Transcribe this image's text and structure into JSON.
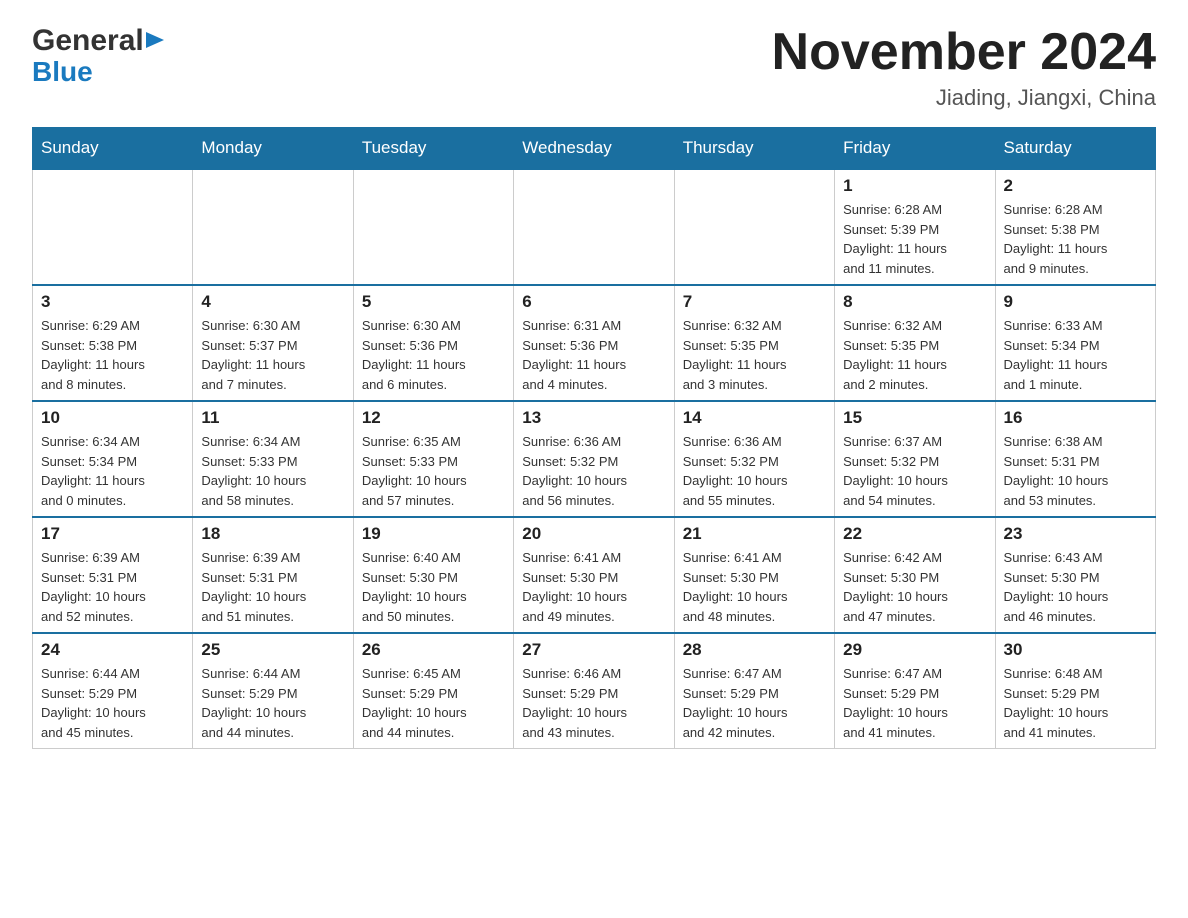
{
  "header": {
    "logo_general": "General",
    "logo_blue": "Blue",
    "main_title": "November 2024",
    "subtitle": "Jiading, Jiangxi, China"
  },
  "weekdays": [
    "Sunday",
    "Monday",
    "Tuesday",
    "Wednesday",
    "Thursday",
    "Friday",
    "Saturday"
  ],
  "weeks": [
    {
      "days": [
        {
          "number": "",
          "info": ""
        },
        {
          "number": "",
          "info": ""
        },
        {
          "number": "",
          "info": ""
        },
        {
          "number": "",
          "info": ""
        },
        {
          "number": "",
          "info": ""
        },
        {
          "number": "1",
          "info": "Sunrise: 6:28 AM\nSunset: 5:39 PM\nDaylight: 11 hours\nand 11 minutes."
        },
        {
          "number": "2",
          "info": "Sunrise: 6:28 AM\nSunset: 5:38 PM\nDaylight: 11 hours\nand 9 minutes."
        }
      ]
    },
    {
      "days": [
        {
          "number": "3",
          "info": "Sunrise: 6:29 AM\nSunset: 5:38 PM\nDaylight: 11 hours\nand 8 minutes."
        },
        {
          "number": "4",
          "info": "Sunrise: 6:30 AM\nSunset: 5:37 PM\nDaylight: 11 hours\nand 7 minutes."
        },
        {
          "number": "5",
          "info": "Sunrise: 6:30 AM\nSunset: 5:36 PM\nDaylight: 11 hours\nand 6 minutes."
        },
        {
          "number": "6",
          "info": "Sunrise: 6:31 AM\nSunset: 5:36 PM\nDaylight: 11 hours\nand 4 minutes."
        },
        {
          "number": "7",
          "info": "Sunrise: 6:32 AM\nSunset: 5:35 PM\nDaylight: 11 hours\nand 3 minutes."
        },
        {
          "number": "8",
          "info": "Sunrise: 6:32 AM\nSunset: 5:35 PM\nDaylight: 11 hours\nand 2 minutes."
        },
        {
          "number": "9",
          "info": "Sunrise: 6:33 AM\nSunset: 5:34 PM\nDaylight: 11 hours\nand 1 minute."
        }
      ]
    },
    {
      "days": [
        {
          "number": "10",
          "info": "Sunrise: 6:34 AM\nSunset: 5:34 PM\nDaylight: 11 hours\nand 0 minutes."
        },
        {
          "number": "11",
          "info": "Sunrise: 6:34 AM\nSunset: 5:33 PM\nDaylight: 10 hours\nand 58 minutes."
        },
        {
          "number": "12",
          "info": "Sunrise: 6:35 AM\nSunset: 5:33 PM\nDaylight: 10 hours\nand 57 minutes."
        },
        {
          "number": "13",
          "info": "Sunrise: 6:36 AM\nSunset: 5:32 PM\nDaylight: 10 hours\nand 56 minutes."
        },
        {
          "number": "14",
          "info": "Sunrise: 6:36 AM\nSunset: 5:32 PM\nDaylight: 10 hours\nand 55 minutes."
        },
        {
          "number": "15",
          "info": "Sunrise: 6:37 AM\nSunset: 5:32 PM\nDaylight: 10 hours\nand 54 minutes."
        },
        {
          "number": "16",
          "info": "Sunrise: 6:38 AM\nSunset: 5:31 PM\nDaylight: 10 hours\nand 53 minutes."
        }
      ]
    },
    {
      "days": [
        {
          "number": "17",
          "info": "Sunrise: 6:39 AM\nSunset: 5:31 PM\nDaylight: 10 hours\nand 52 minutes."
        },
        {
          "number": "18",
          "info": "Sunrise: 6:39 AM\nSunset: 5:31 PM\nDaylight: 10 hours\nand 51 minutes."
        },
        {
          "number": "19",
          "info": "Sunrise: 6:40 AM\nSunset: 5:30 PM\nDaylight: 10 hours\nand 50 minutes."
        },
        {
          "number": "20",
          "info": "Sunrise: 6:41 AM\nSunset: 5:30 PM\nDaylight: 10 hours\nand 49 minutes."
        },
        {
          "number": "21",
          "info": "Sunrise: 6:41 AM\nSunset: 5:30 PM\nDaylight: 10 hours\nand 48 minutes."
        },
        {
          "number": "22",
          "info": "Sunrise: 6:42 AM\nSunset: 5:30 PM\nDaylight: 10 hours\nand 47 minutes."
        },
        {
          "number": "23",
          "info": "Sunrise: 6:43 AM\nSunset: 5:30 PM\nDaylight: 10 hours\nand 46 minutes."
        }
      ]
    },
    {
      "days": [
        {
          "number": "24",
          "info": "Sunrise: 6:44 AM\nSunset: 5:29 PM\nDaylight: 10 hours\nand 45 minutes."
        },
        {
          "number": "25",
          "info": "Sunrise: 6:44 AM\nSunset: 5:29 PM\nDaylight: 10 hours\nand 44 minutes."
        },
        {
          "number": "26",
          "info": "Sunrise: 6:45 AM\nSunset: 5:29 PM\nDaylight: 10 hours\nand 44 minutes."
        },
        {
          "number": "27",
          "info": "Sunrise: 6:46 AM\nSunset: 5:29 PM\nDaylight: 10 hours\nand 43 minutes."
        },
        {
          "number": "28",
          "info": "Sunrise: 6:47 AM\nSunset: 5:29 PM\nDaylight: 10 hours\nand 42 minutes."
        },
        {
          "number": "29",
          "info": "Sunrise: 6:47 AM\nSunset: 5:29 PM\nDaylight: 10 hours\nand 41 minutes."
        },
        {
          "number": "30",
          "info": "Sunrise: 6:48 AM\nSunset: 5:29 PM\nDaylight: 10 hours\nand 41 minutes."
        }
      ]
    }
  ]
}
